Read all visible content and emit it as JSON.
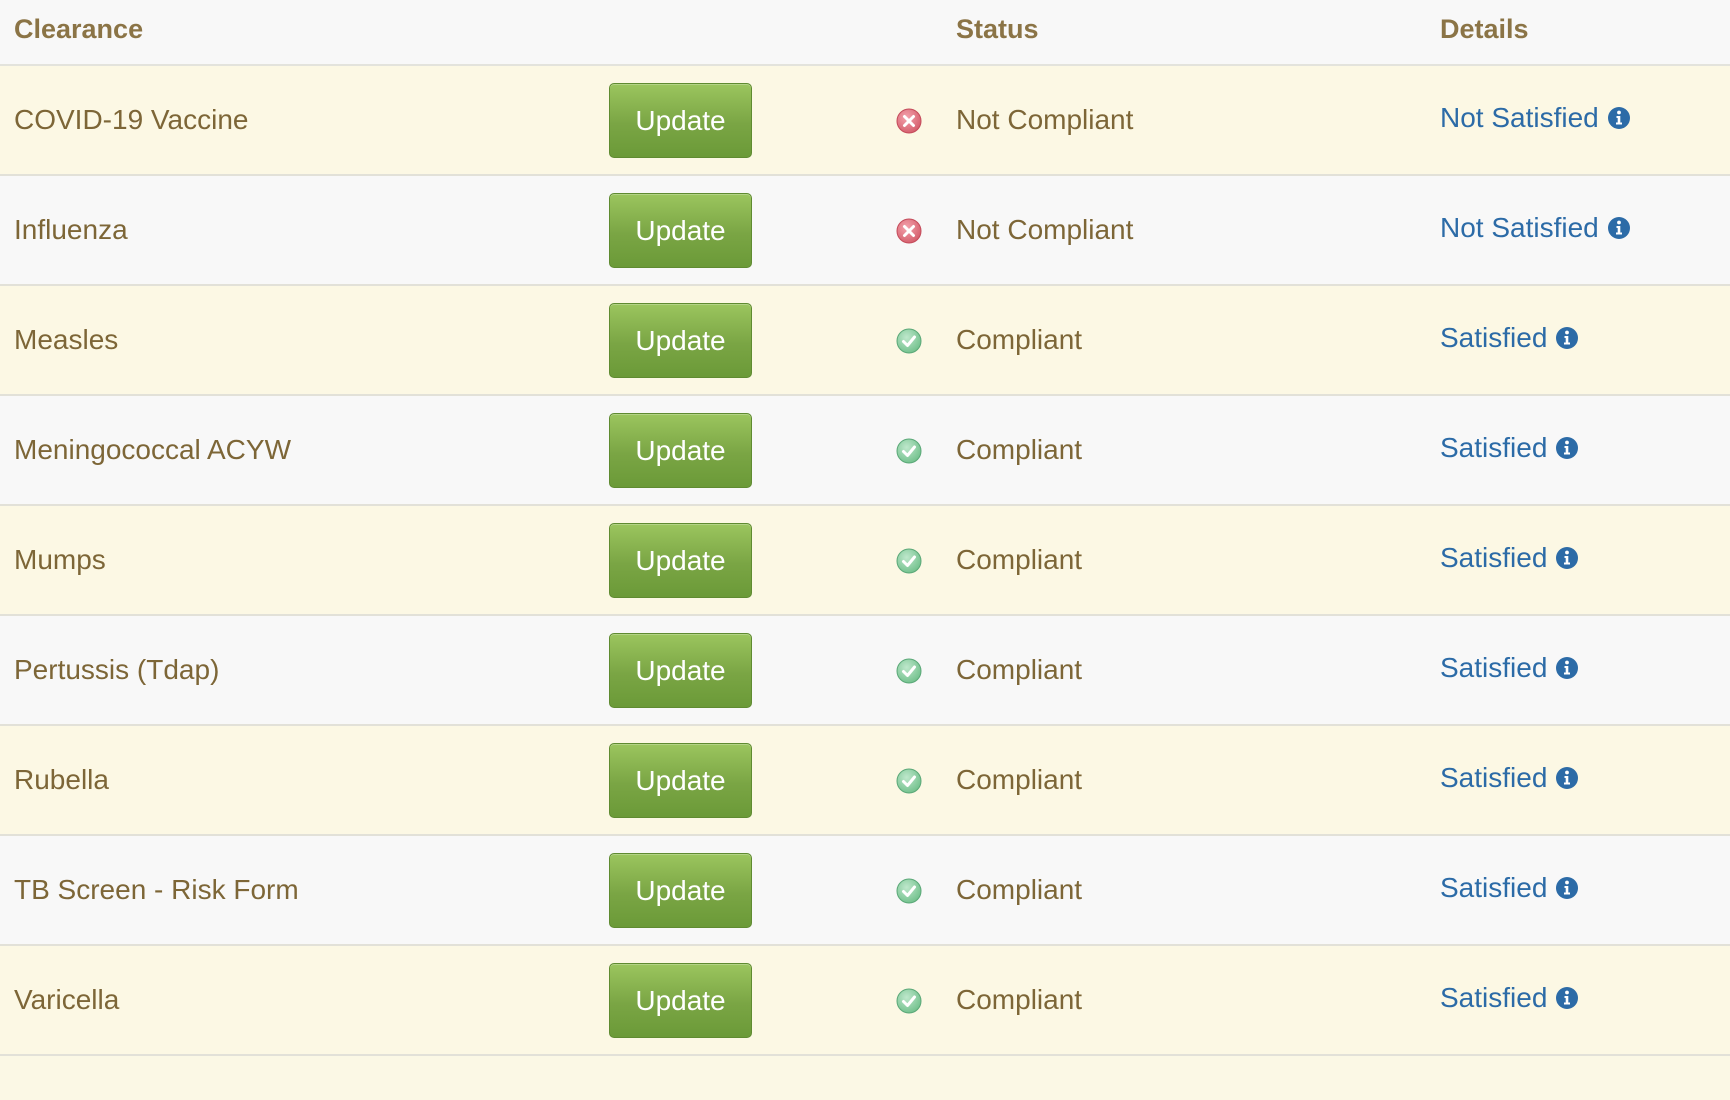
{
  "header": {
    "clearance": "Clearance",
    "status": "Status",
    "details": "Details"
  },
  "button_label": "Update",
  "colors": {
    "compliant_icon": "#6fbf8a",
    "not_compliant_icon": "#d35c6a",
    "details_link": "#2c6ba7",
    "button_green": "#7aa544"
  },
  "rows": [
    {
      "name": "COVID-19 Vaccine",
      "status": "Not Compliant",
      "status_icon": "x-circle-icon",
      "details": "Not Satisfied"
    },
    {
      "name": "Influenza",
      "status": "Not Compliant",
      "status_icon": "x-circle-icon",
      "details": "Not Satisfied"
    },
    {
      "name": "Measles",
      "status": "Compliant",
      "status_icon": "check-circle-icon",
      "details": "Satisfied"
    },
    {
      "name": "Meningococcal ACYW",
      "status": "Compliant",
      "status_icon": "check-circle-icon",
      "details": "Satisfied"
    },
    {
      "name": "Mumps",
      "status": "Compliant",
      "status_icon": "check-circle-icon",
      "details": "Satisfied"
    },
    {
      "name": "Pertussis (Tdap)",
      "status": "Compliant",
      "status_icon": "check-circle-icon",
      "details": "Satisfied"
    },
    {
      "name": "Rubella",
      "status": "Compliant",
      "status_icon": "check-circle-icon",
      "details": "Satisfied"
    },
    {
      "name": "TB Screen - Risk Form",
      "status": "Compliant",
      "status_icon": "check-circle-icon",
      "details": "Satisfied"
    },
    {
      "name": "Varicella",
      "status": "Compliant",
      "status_icon": "check-circle-icon",
      "details": "Satisfied"
    }
  ]
}
